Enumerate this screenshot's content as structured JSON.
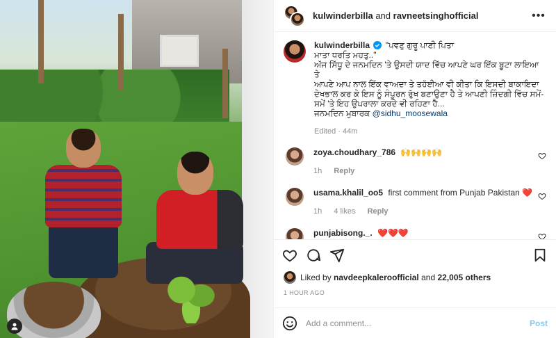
{
  "header": {
    "user1": "kulwinderbilla",
    "and_text": "and",
    "user2": "ravneetsinghofficial",
    "more_label": "•••"
  },
  "caption": {
    "username": "kulwinderbilla",
    "text": "\"ਪਵਣੁ ਗੁਰੂ ਪਾਣੀ ਪਿਤਾ\nਮਾਤਾ ਧਰਤਿ ਮਹਤੁ..\"\nਅੱਜ ਸਿੱਧੂ ਦੇ ਜਨਮਦਿਨ 'ਤੇ ਉਸਦੀ ਯਾਦ ਵਿੱਚ ਆਪਣੇ ਘਰ ਇੱਕ ਬੂਟਾ ਲਾਇਆ ਤੇ\nਆਪਣੇ ਆਪ ਨਾਲ ਇੱਕ ਵਾਅਦਾ ਤੇ ਤਹੱਈਆ ਵੀ ਕੀਤਾ ਕਿ ਇਸਦੀ ਬਾਕਾਇਦਾ\nਦੇਖਭਾਲ ਕਰ ਕੇ ਇਸ ਨੂੰ ਸੰਪੂਰਨ ਰੁੱਖ ਬਣਾਉਣਾ ਹੈ ਤੇ ਆਪਣੀ ਜ਼ਿੰਦਗੀ ਵਿੱਚ ਸਮੇਂ-\nਸਮੇਂ 'ਤੇ ਇਹ ਉਪਰਾਲਾ ਕਰਦੇ ਵੀ ਰਹਿਣਾ ਹੈ...\nਜਨਮਦਿਨ ਮੁਬਾਰਕ",
    "mention": "@sidhu_moosewala",
    "meta": "Edited · 44m"
  },
  "comments": [
    {
      "username": "zoya.choudhary_786",
      "text": "🙌🙌🙌🙌",
      "time": "1h",
      "likes": "",
      "reply": "Reply"
    },
    {
      "username": "usama.khalil_oo5",
      "text": "first comment from Punjab Pakistan ❤️",
      "time": "1h",
      "likes": "4 likes",
      "reply": "Reply"
    },
    {
      "username": "punjabisong._.",
      "text": "❤️❤️❤️",
      "time": "",
      "likes": "",
      "reply": ""
    }
  ],
  "likes": {
    "prefix": "Liked by",
    "user": "navdeepkaleroofficial",
    "and_text": "and",
    "others": "22,005 others"
  },
  "timestamp": "1 HOUR AGO",
  "add_comment": {
    "placeholder": "Add a comment...",
    "post_label": "Post"
  }
}
